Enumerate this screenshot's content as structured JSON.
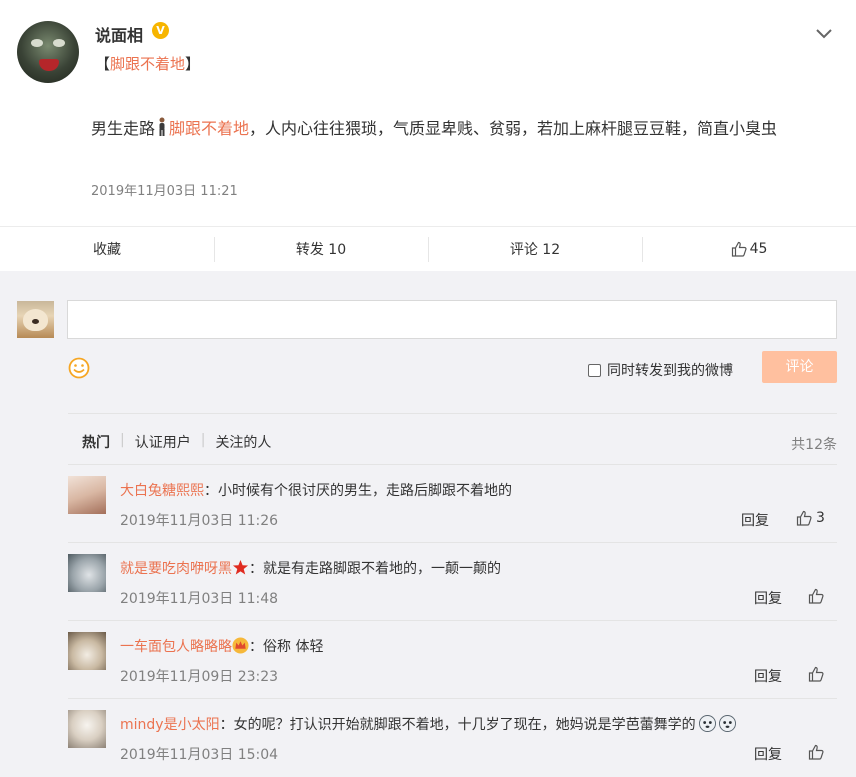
{
  "post": {
    "username": "说面相",
    "verified_badge": "V",
    "topic_open": "【",
    "topic": "脚跟不着地",
    "topic_close": "】",
    "content_pre": "男生走路",
    "content_topic": "脚跟不着地",
    "content_post": "，人内心往往猥琐，气质显卑贱、贫弱，若加上麻杆腿豆豆鞋，简直小臭虫",
    "time": "2019年11月03日 11:21"
  },
  "actions": {
    "favorite": "收藏",
    "repost": "转发 10",
    "comment": "评论 12",
    "like_count": "45"
  },
  "composer": {
    "placeholder": "",
    "repost_label": "同时转发到我的微博",
    "submit_label": "评论"
  },
  "comment_list": {
    "tabs": [
      "热门",
      "认证用户",
      "关注的人"
    ],
    "total": "共12条",
    "items": [
      {
        "name": "大白兔糖熙熙",
        "sep": "：",
        "text": "小时候有个很讨厌的男生，走路后脚跟不着地的",
        "time": "2019年11月03日 11:26",
        "reply": "回复",
        "likes": "3"
      },
      {
        "name": "就是要吃肉咿呀黑",
        "sep": "：",
        "text": "就是有走路脚跟不着地的，一颠一颠的",
        "time": "2019年11月03日 11:48",
        "reply": "回复",
        "likes": ""
      },
      {
        "name": "一车面包人略略略",
        "sep": "：",
        "text": "俗称 体轻",
        "time": "2019年11月09日 23:23",
        "reply": "回复",
        "likes": ""
      },
      {
        "name": "mindy是小太阳",
        "sep": "：",
        "text": "女的呢？打认识开始就脚跟不着地，十几岁了现在，她妈说是学芭蕾舞学的",
        "time": "2019年11月03日 15:04",
        "reply": "回复",
        "likes": ""
      }
    ]
  },
  "colors": {
    "accent": "#eb7350",
    "link_name": "#eb7350",
    "submit_disabled": "#ffc09f",
    "muted": "#808080",
    "panel_bg": "#f2f2f5"
  }
}
